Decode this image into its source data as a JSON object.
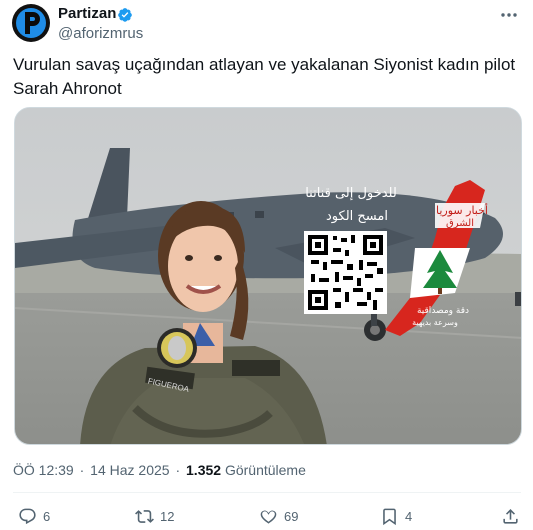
{
  "author": {
    "display_name": "Partizan",
    "handle": "@aforizmrus",
    "avatar_letter": "P",
    "verified": true
  },
  "tweet": {
    "text": "Vurulan savaş uçağından atlayan ve yakalanan Siyonist kadın pilot Sarah Ahronot"
  },
  "media": {
    "overlay_text_line1": "للدخول إلى قناتنا",
    "overlay_text_line2": "امسح الكود",
    "brand_text_line1": "أخبار سوريا",
    "brand_text_line2": "الشرق",
    "brand_text_line3": "دقة ومصداقية",
    "brand_text_line4": "وسرعة بديهية",
    "name_tag": "FIGUEROA"
  },
  "meta": {
    "time": "ÖÖ 12:39",
    "separator": "·",
    "date": "14 Haz 2025",
    "views_count": "1.352",
    "views_label": "Görüntüleme"
  },
  "actions": {
    "replies": "6",
    "retweets": "12",
    "likes": "69",
    "bookmarks": "4"
  },
  "colors": {
    "accent": "#1d9bf0",
    "text": "#0f1419",
    "secondary": "#536471"
  }
}
